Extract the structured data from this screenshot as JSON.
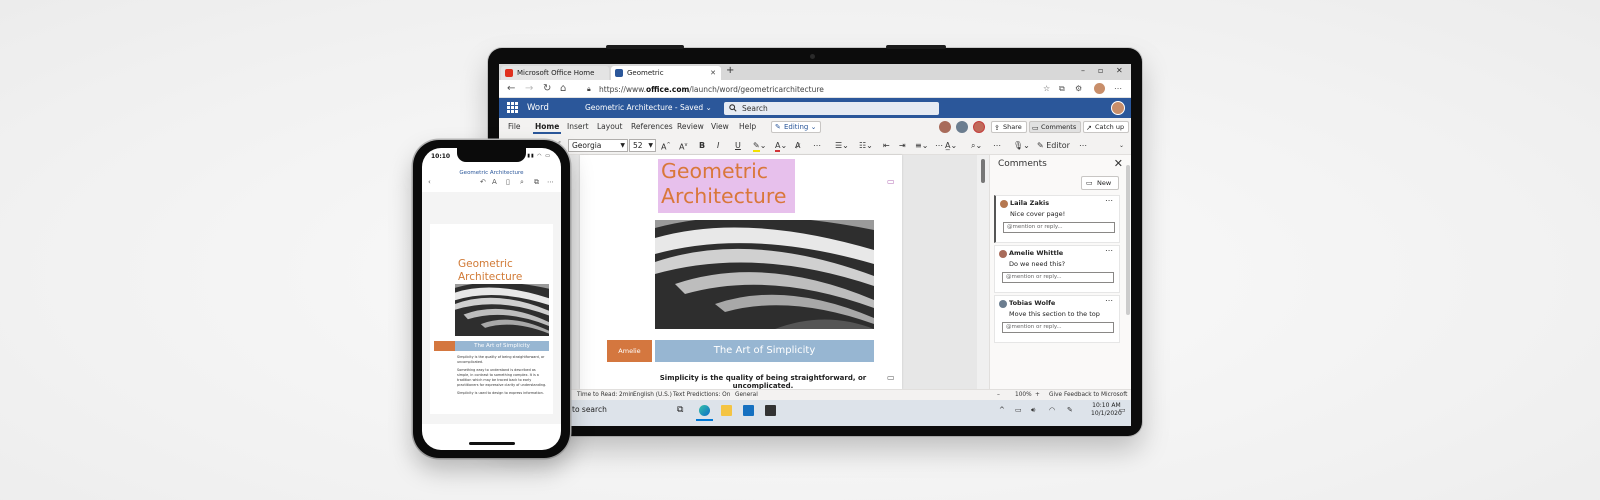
{
  "browser": {
    "tabs": [
      {
        "label": "Microsoft Office Home",
        "active": false
      },
      {
        "label": "Geometric Architecture.docx",
        "active": true
      }
    ],
    "url_prefix": "https://www.",
    "url_domain": "office.com",
    "url_path": "/launch/word/geometricarchitecture"
  },
  "word": {
    "app_name": "Word",
    "doc_title": "Geometric Architecture - Saved",
    "search_placeholder": "Search",
    "menu": [
      "File",
      "Home",
      "Insert",
      "Layout",
      "References",
      "Review",
      "View",
      "Help"
    ],
    "active_menu": "Home",
    "editing_label": "Editing",
    "share_label": "Share",
    "comments_label": "Comments",
    "catchup_label": "Catch up",
    "font_name": "Georgia",
    "font_size": "52",
    "editor_label": "Editor"
  },
  "document": {
    "title_line1": "Geometric",
    "title_line2": "Architecture",
    "author": "Amelie Whittle",
    "section_heading": "The Art of Simplicity",
    "body_first_line": "Simplicity is the quality of being straightforward, or uncomplicated."
  },
  "comments_pane": {
    "title": "Comments",
    "new_label": "New",
    "cards": [
      {
        "author": "Laila Zakis",
        "text": "Nice cover page!",
        "reply_placeholder": "@mention or reply...",
        "avatar_color": "#b5774f"
      },
      {
        "author": "Amelie Whittle",
        "text": "Do we need this?",
        "reply_placeholder": "@mention or reply...",
        "avatar_color": "#a86b5a"
      },
      {
        "author": "Tobias Wolfe",
        "text": "Move this section to the top",
        "reply_placeholder": "@mention or reply...",
        "avatar_color": "#6b7d8f"
      }
    ]
  },
  "status_bar": {
    "read_time": "Time to Read: 2min",
    "language": "English (U.S.)",
    "predictions": "Text Predictions: On",
    "sensitivity": "General",
    "zoom": "100%",
    "feedback": "Give Feedback to Microsoft"
  },
  "taskbar": {
    "search_text": "to search",
    "time": "10:10 AM",
    "date": "10/1/2020"
  },
  "phone": {
    "time": "10:10",
    "doc_title": "Geometric Architecture",
    "body_lines": [
      "Simplicity is the quality of being straightforward, or uncomplicated.",
      "Something easy to understand is described as simple, in contrast to something complex. It is a tradition which may be traced back to early practitioners for expressive clarity of understanding.",
      "Simplicity is used to design to express information."
    ]
  },
  "colors": {
    "word_blue": "#2b579a",
    "title_orange": "#d9773a",
    "title_highlight": "#e7c0ec",
    "band_blue": "#97b6d2",
    "author_orange": "#d4773f"
  }
}
